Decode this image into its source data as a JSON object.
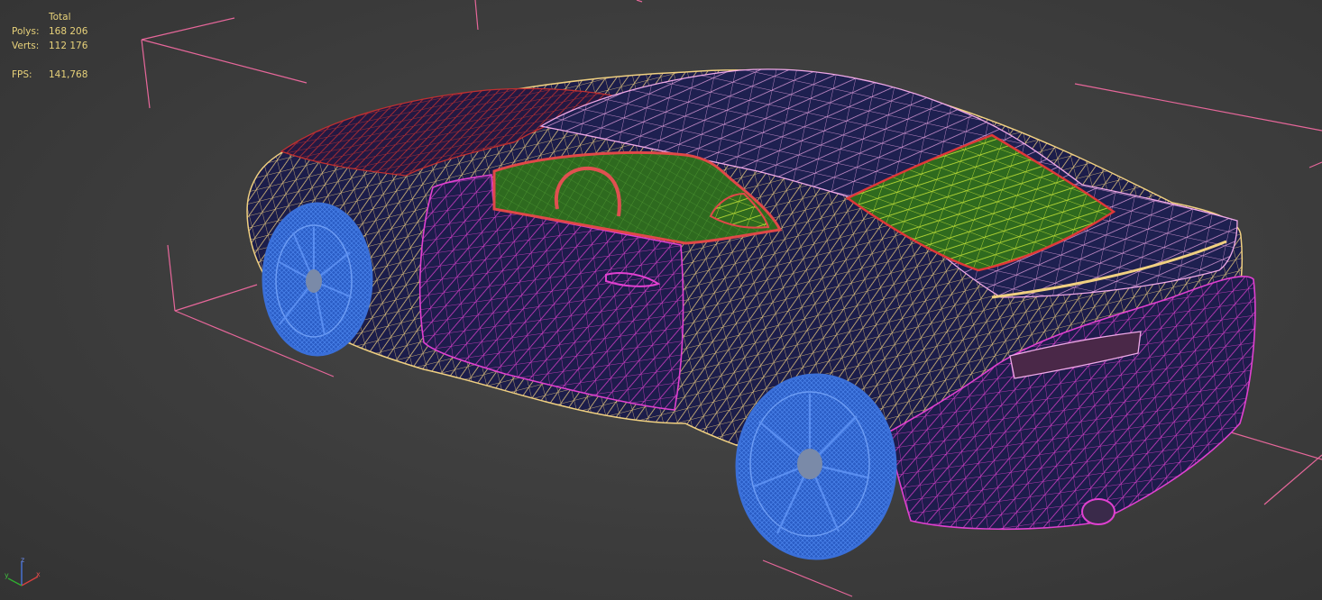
{
  "stats": {
    "header": "Total",
    "polys_label": "Polys:",
    "polys_value": "168 206",
    "verts_label": "Verts:",
    "verts_value": "112 176",
    "fps_label": "FPS:",
    "fps_value": "141,768"
  },
  "axis_gizmo": {
    "x_label": "x",
    "y_label": "y",
    "z_label": "z"
  },
  "colors": {
    "background": "#3f3f3f",
    "stats_text": "#e8d27a",
    "bounding_box": "#e6679a",
    "body_wire": "#f0d080",
    "panel_wire": "#e040d0",
    "roof_wire": "#f0a8e8",
    "hood_wire": "#c03030",
    "wheel_wire": "#3a6fd8",
    "glass_wire": "#c8e838",
    "interior": "#2f6a1e",
    "fill_navy": "#1c1d4a"
  }
}
